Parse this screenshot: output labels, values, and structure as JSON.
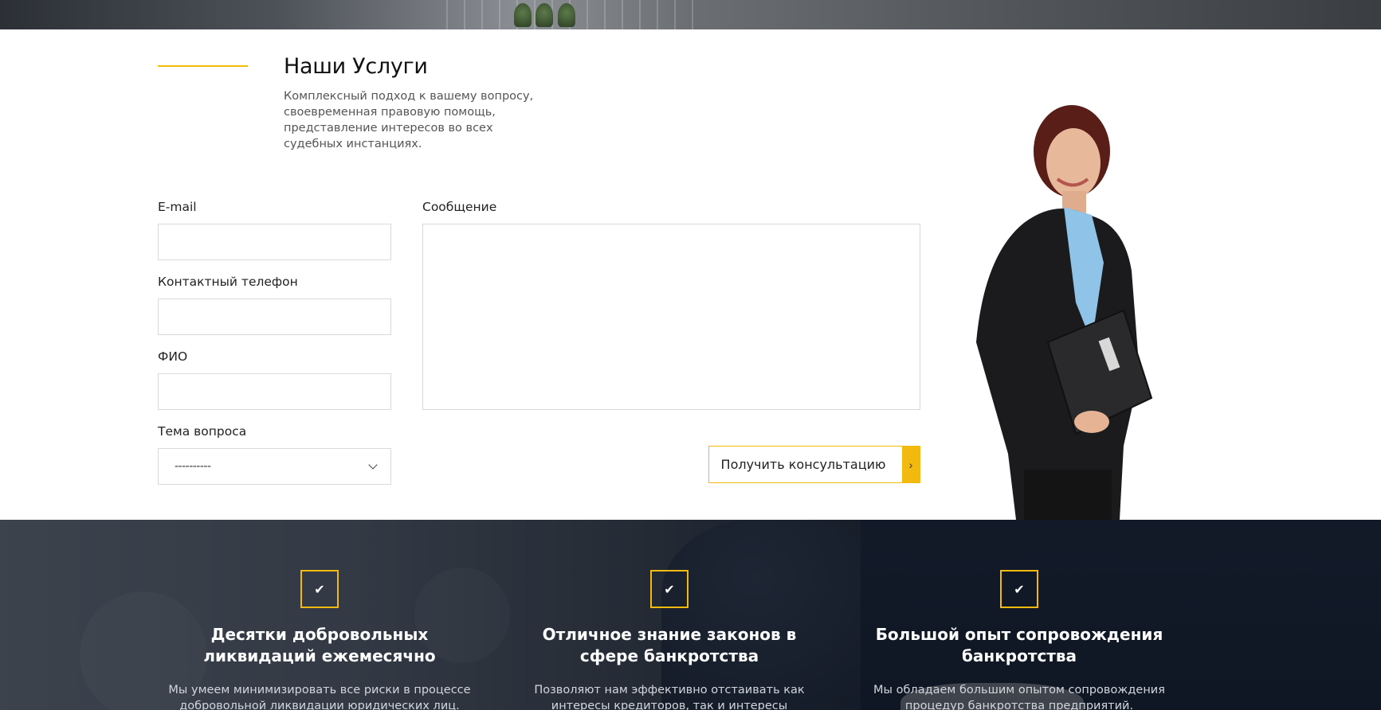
{
  "services": {
    "title": "Наши Услуги",
    "description": "Комплексный подход к вашему вопросу, своевременная правовую помощь, представление интересов во всех судебных инстанциях."
  },
  "form": {
    "email_label": "E-mail",
    "email_value": "",
    "phone_label": "Контактный телефон",
    "phone_value": "",
    "name_label": "ФИО",
    "name_value": "",
    "topic_label": "Тема вопроса",
    "topic_selected": "----------",
    "message_label": "Сообщение",
    "message_value": "",
    "submit_label": "Получить консультацию",
    "submit_arrow": "›"
  },
  "features": [
    {
      "icon": "check-icon",
      "title": "Десятки добровольных ликвидаций ежемесячно",
      "text": "Мы умеем минимизировать все риски в процессе добровольной ликвидации юридических лиц."
    },
    {
      "icon": "check-icon",
      "title": "Отличное знание законов в сфере банкротства",
      "text": "Позволяют нам эффективно отстаивать как интересы кредиторов, так и интересы"
    },
    {
      "icon": "check-icon",
      "title": "Большой опыт сопровождения банкротства",
      "text": "Мы обладаем большим опытом сопровождения процедур банкротства предприятий."
    }
  ],
  "colors": {
    "accent": "#f2b90f",
    "dark_section": "#1f2530"
  }
}
